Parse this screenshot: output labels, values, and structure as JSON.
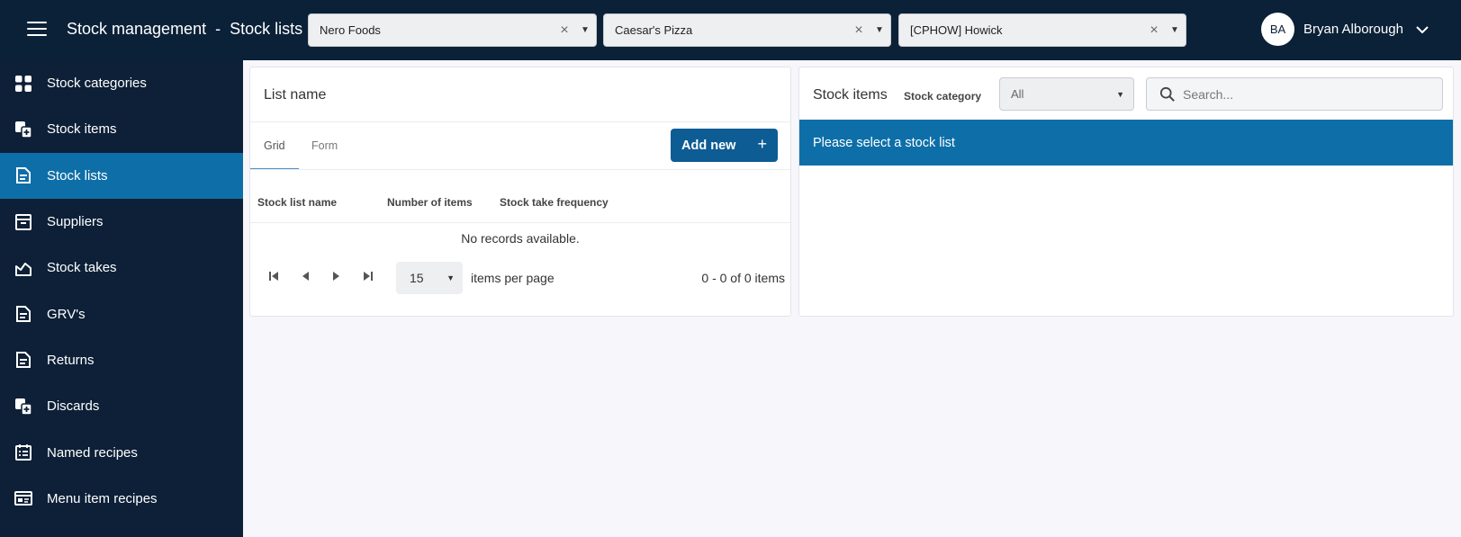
{
  "header": {
    "title": "Stock management",
    "separator": "-",
    "subtitle": "Stock lists",
    "selectors": [
      {
        "value": "Nero Foods"
      },
      {
        "value": "Caesar's Pizza"
      },
      {
        "value": "[CPHOW] Howick"
      }
    ],
    "user": {
      "initials": "BA",
      "name": "Bryan Alborough"
    }
  },
  "sidebar": {
    "items": [
      {
        "label": "Stock categories",
        "icon": "grid-icon"
      },
      {
        "label": "Stock items",
        "icon": "stock-items-icon"
      },
      {
        "label": "Stock lists",
        "icon": "document-icon",
        "active": true
      },
      {
        "label": "Suppliers",
        "icon": "archive-icon"
      },
      {
        "label": "Stock takes",
        "icon": "chart-icon"
      },
      {
        "label": "GRV's",
        "icon": "document-icon"
      },
      {
        "label": "Returns",
        "icon": "document-icon"
      },
      {
        "label": "Discards",
        "icon": "stock-items-icon"
      },
      {
        "label": "Named recipes",
        "icon": "recipe-icon"
      },
      {
        "label": "Menu item recipes",
        "icon": "menu-card-icon"
      }
    ]
  },
  "list_panel": {
    "title": "List name",
    "tabs": [
      "Grid",
      "Form"
    ],
    "add_button": "Add new",
    "columns": [
      "Stock list name",
      "Number of items",
      "Stock take frequency"
    ],
    "empty_text": "No records available.",
    "page_size": "15",
    "items_per_page": "items per page",
    "count_text": "0 - 0 of 0 items"
  },
  "items_panel": {
    "title": "Stock items",
    "category_label": "Stock category",
    "category_value": "All",
    "search_placeholder": "Search...",
    "banner": "Please select a stock list"
  },
  "colors": {
    "topbar": "#0b2138",
    "sidebar": "#0d2037",
    "accent": "#0e6fa8",
    "button": "#0d5c94"
  }
}
